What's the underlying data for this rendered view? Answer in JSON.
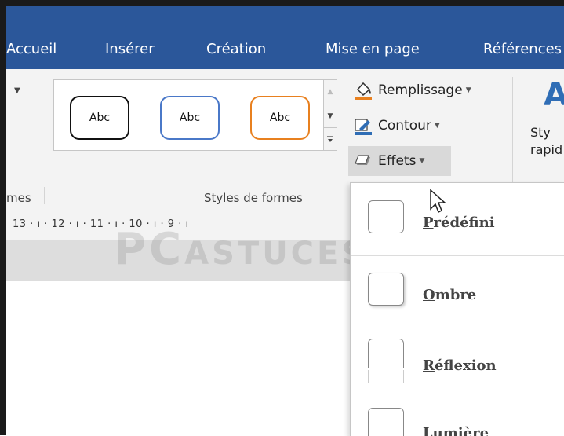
{
  "tabs": [
    {
      "label": "Accueil"
    },
    {
      "label": "Insérer"
    },
    {
      "label": "Création"
    },
    {
      "label": "Mise en page"
    },
    {
      "label": "Références"
    }
  ],
  "gallery": {
    "shapes": [
      {
        "label": "Abc",
        "border_color": "#111111"
      },
      {
        "label": "Abc",
        "border_color": "#4a78c8"
      },
      {
        "label": "Abc",
        "border_color": "#e8801f"
      }
    ]
  },
  "commands": {
    "remplissage": "Remplissage",
    "contour": "Contour",
    "effets": "Effets"
  },
  "styles_rapides": {
    "line1": "Sty",
    "line2": "rapid"
  },
  "group_labels": {
    "left": "mes",
    "styles": "Styles de formes"
  },
  "ruler": {
    "text": "13 · ı · 12 · ı · 11 · ı · 10 · ı · 9 · ı"
  },
  "watermark": {
    "big": "PC",
    "small": "ASTUCES"
  },
  "effets_menu": {
    "items": [
      {
        "first": "P",
        "rest": "rédéfini"
      },
      {
        "first": "O",
        "rest": "mbre"
      },
      {
        "first": "R",
        "rest": "éflexion"
      },
      {
        "first": "L",
        "rest": "umière"
      }
    ]
  },
  "colors": {
    "tabbar": "#2b579a",
    "ribbon": "#f3f3f3",
    "accent": "#2f6db5"
  }
}
